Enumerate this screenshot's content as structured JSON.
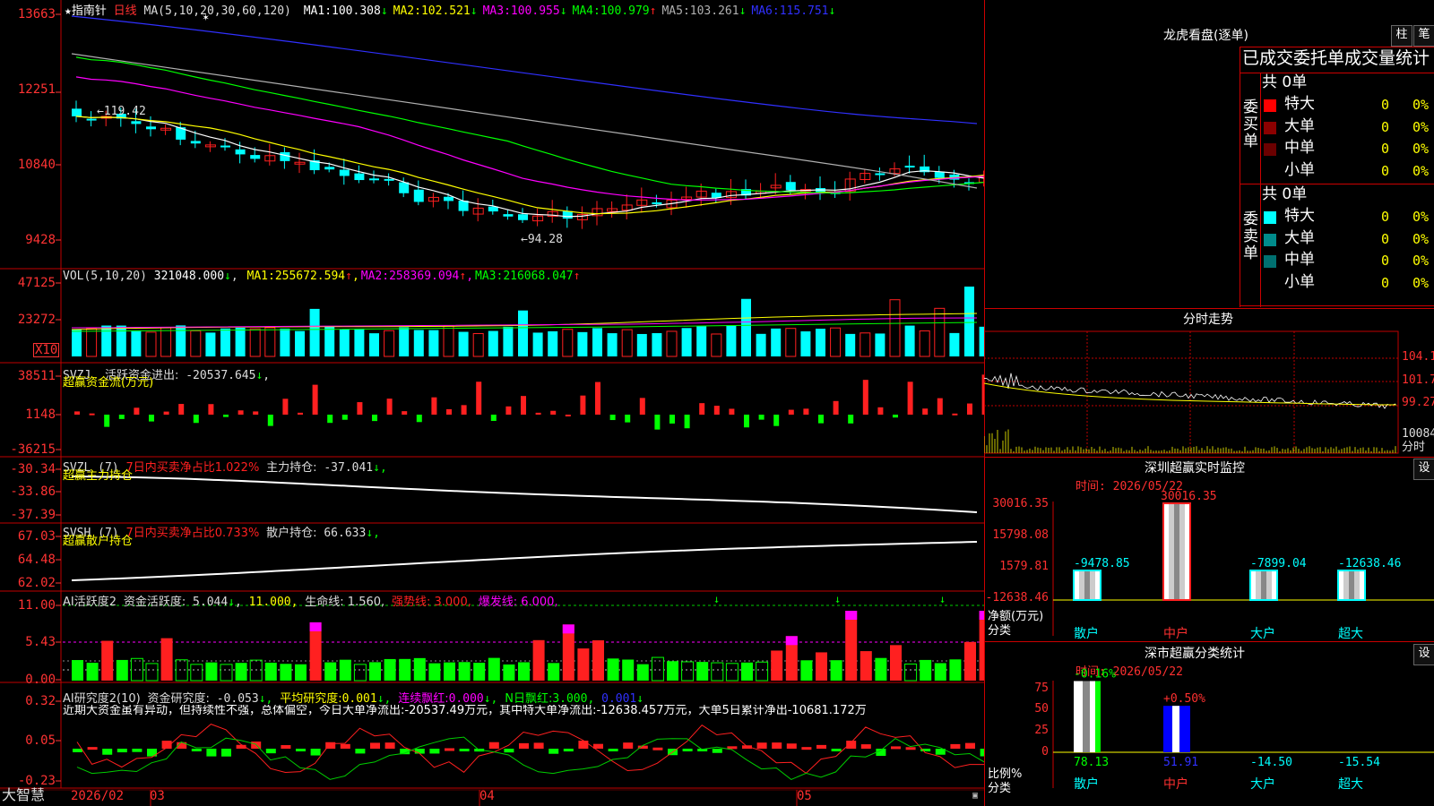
{
  "colors": {
    "up": "#ff2020",
    "down": "#00ffff",
    "ma1": "#ffffff",
    "ma2": "#ffff00",
    "ma3": "#ff00ff",
    "ma4": "#00ff00",
    "ma5": "#b0b0b0",
    "ma6": "#3030ff",
    "grid": "#c00000"
  },
  "main": {
    "star": "★",
    "name": "指南针",
    "period": "日线",
    "ma_title": "MA(5,10,20,30,60,120)",
    "ma_items": [
      {
        "label": "MA1:",
        "value": "100.308",
        "arrow": "↓",
        "color": "#ffffff"
      },
      {
        "label": "MA2:",
        "value": "102.521",
        "arrow": "↓",
        "color": "#ffff00"
      },
      {
        "label": "MA3:",
        "value": "100.955",
        "arrow": "↓",
        "color": "#ff00ff"
      },
      {
        "label": "MA4:",
        "value": "100.979",
        "arrow": "↑",
        "color": "#00ff00"
      },
      {
        "label": "MA5:",
        "value": "103.261",
        "arrow": "↓",
        "color": "#b0b0b0"
      },
      {
        "label": "MA6:",
        "value": "115.751",
        "arrow": "↓",
        "color": "#3030ff"
      }
    ],
    "yaxis": [
      "13663",
      "12251",
      "10840",
      "9428"
    ],
    "hi_label": "←119.42",
    "lo_label": "←94.28"
  },
  "vol": {
    "title": "VOL(5,10,20)",
    "value": "321048.000",
    "value_arrow": "↓",
    "items": [
      {
        "label": "MA1:",
        "value": "255672.594",
        "arrow": "↑",
        "color": "#ffff00"
      },
      {
        "label": "MA2:",
        "value": "258369.094",
        "arrow": "↑",
        "color": "#ff00ff"
      },
      {
        "label": "MA3:",
        "value": "216068.047",
        "arrow": "↑",
        "color": "#00ff00"
      }
    ],
    "yaxis": [
      "47125",
      "23272"
    ],
    "unit": "X10"
  },
  "svzj": {
    "title": "SVZJ",
    "label": "活跃资金进出:",
    "value": "-20537.645",
    "arrow": "↓",
    "subtitle": "超赢资金流(万元)",
    "yaxis": [
      "38511",
      "1148",
      "-36215"
    ]
  },
  "svzl": {
    "title": "SVZL (7)",
    "item1": "7日内买卖净占比1.022%",
    "label": "主力持仓:",
    "value": "-37.041",
    "arrow": "↓,",
    "subtitle": "超赢主力持仓",
    "yaxis": [
      "-30.34",
      "-33.86",
      "-37.39"
    ]
  },
  "svsh": {
    "title": "SVSH (7)",
    "item1": "7日内买卖净占比0.733%",
    "label": "散户持仓:",
    "value": "66.633",
    "arrow": "↓,",
    "subtitle": "超赢散户持仓",
    "yaxis": [
      "67.03",
      "64.48",
      "62.02"
    ]
  },
  "ai1": {
    "title": "AI活跃度2",
    "label": "资金活跃度:",
    "value": "5.044",
    "arrow": "↓",
    "v2": "11.000,",
    "v3": "生命线: 1.560,",
    "v4": "强势线: 3.000,",
    "v5": "爆发线: 6.000,",
    "yaxis": [
      "11.00",
      "5.43",
      "0.00"
    ]
  },
  "ai2": {
    "title": "AI研究度2(10)",
    "label": "资金研究度:",
    "value": "-0.053",
    "arrow": "↓,",
    "label2": "平均研究度:",
    "value2": "0.001",
    "arrow2": "↓,",
    "label3": "连续飘红:",
    "value3": "0.000",
    "arrow3": "↓,",
    "label4": "N日飘红:",
    "value4": "3.000,",
    "value5": "0.001",
    "arrow5": "↓",
    "comment": "近期大资金虽有异动，但持续性不强，总体偏空，今日大单净流出:-20537.49万元，其中特大单净流出:-12638.457万元，大单5日累计净出-10681.172万",
    "yaxis": [
      "0.32",
      "0.05",
      "-0.23"
    ]
  },
  "bottom": {
    "brand": "大智慧",
    "dates": [
      "2026/02",
      "03",
      "04",
      "05"
    ]
  },
  "right": {
    "title": "龙虎看盘(逐单)",
    "btn1": "柱",
    "btn2": "笔",
    "table_title": "已成交委托单成交量统计",
    "buy": {
      "side": "委买单",
      "total": "共 0单",
      "rows": [
        {
          "name": "特大",
          "vol": "0",
          "pct": "0%",
          "color": "#ff0000"
        },
        {
          "name": "大单",
          "vol": "0",
          "pct": "0%",
          "color": "#8b0000"
        },
        {
          "name": "中单",
          "vol": "0",
          "pct": "0%",
          "color": "#6b0000"
        },
        {
          "name": "小单",
          "vol": "0",
          "pct": "0%",
          "color": ""
        }
      ]
    },
    "sell": {
      "side": "委卖单",
      "total": "共 0单",
      "rows": [
        {
          "name": "特大",
          "vol": "0",
          "pct": "0%",
          "color": "#00ffff"
        },
        {
          "name": "大单",
          "vol": "0",
          "pct": "0%",
          "color": "#008b8b"
        },
        {
          "name": "中单",
          "vol": "0",
          "pct": "0%",
          "color": "#007070"
        },
        {
          "name": "小单",
          "vol": "0",
          "pct": "0%",
          "color": ""
        }
      ]
    },
    "intraday": {
      "title": "分时走势",
      "yaxis": [
        "104.1",
        "101.7",
        "99.27",
        "10084"
      ],
      "label": "分时"
    },
    "monitor": {
      "title": "深圳超赢实时监控",
      "btn": "设",
      "date": "时间: 2026/05/22",
      "yaxis": [
        "30016.35",
        "15798.08",
        "1579.81",
        "-12638.46"
      ],
      "ylabel": "净额(万元)",
      "xlabel_title": "分类",
      "chart_data": {
        "type": "bar",
        "categories": [
          "散户",
          "中户",
          "大户",
          "超大"
        ],
        "values": [
          -9478.85,
          30016.35,
          -7899.04,
          -12638.46
        ],
        "labels": [
          "-9478.85",
          "30016.35",
          "-7899.04",
          "-12638.46"
        ],
        "ylim": [
          -12638.46,
          30016.35
        ]
      }
    },
    "classify": {
      "title": "深市超赢分类统计",
      "btn": "设",
      "date": "时间: 2026/05/22",
      "yaxis": [
        "75",
        "50",
        "25",
        "0"
      ],
      "ylabel": "比例%",
      "xlabel_title": "分类",
      "chart_data": {
        "type": "bar",
        "categories": [
          "散户",
          "中户",
          "大户",
          "超大"
        ],
        "values": [
          78.13,
          51.91,
          -14.5,
          -15.54
        ],
        "top_labels": [
          "-0.16%",
          "+0.50%",
          "",
          ""
        ],
        "bottom_labels": [
          "78.13",
          "51.91",
          "-14.50",
          "-15.54"
        ],
        "ylim": [
          0,
          75
        ]
      }
    }
  }
}
